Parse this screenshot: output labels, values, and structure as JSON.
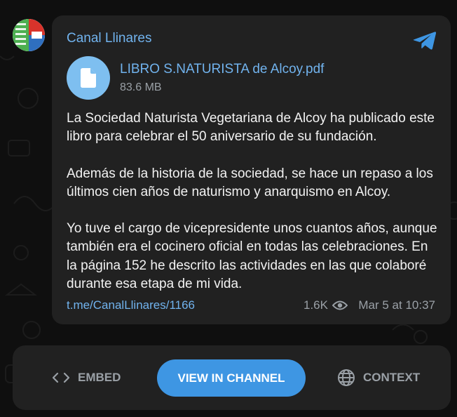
{
  "channel": {
    "name": "Canal Llinares",
    "avatar_icon": "channel-avatar-logo"
  },
  "attachment": {
    "icon": "document-icon",
    "file_name": "LIBRO S.NATURISTA de Alcoy.pdf",
    "file_size": "83.6 MB"
  },
  "message": {
    "paragraphs": [
      "La Sociedad Naturista Vegetariana de Alcoy ha publicado este libro para celebrar el 50 aniversario de su fundación.",
      "Además de la historia de la sociedad, se hace un repaso a los últimos cien años de naturismo y anarquismo en Alcoy.",
      "Yo tuve el cargo de vicepresidente unos cuantos años, aunque también era el cocinero oficial en todas las celebraciones. En la página 152 he descrito las actividades en las que colaboré durante esa etapa de mi vida."
    ],
    "link": "t.me/CanalLlinares/1166",
    "views": "1.6K",
    "date": "Mar 5 at 10:37"
  },
  "footer": {
    "embed_label": "EMBED",
    "view_label": "VIEW IN CHANNEL",
    "context_label": "CONTEXT"
  },
  "colors": {
    "background": "#0f0f0f",
    "bubble": "#212121",
    "accent": "#71b3ee",
    "primary_button": "#3e96e3",
    "muted": "#9aa0a6"
  }
}
